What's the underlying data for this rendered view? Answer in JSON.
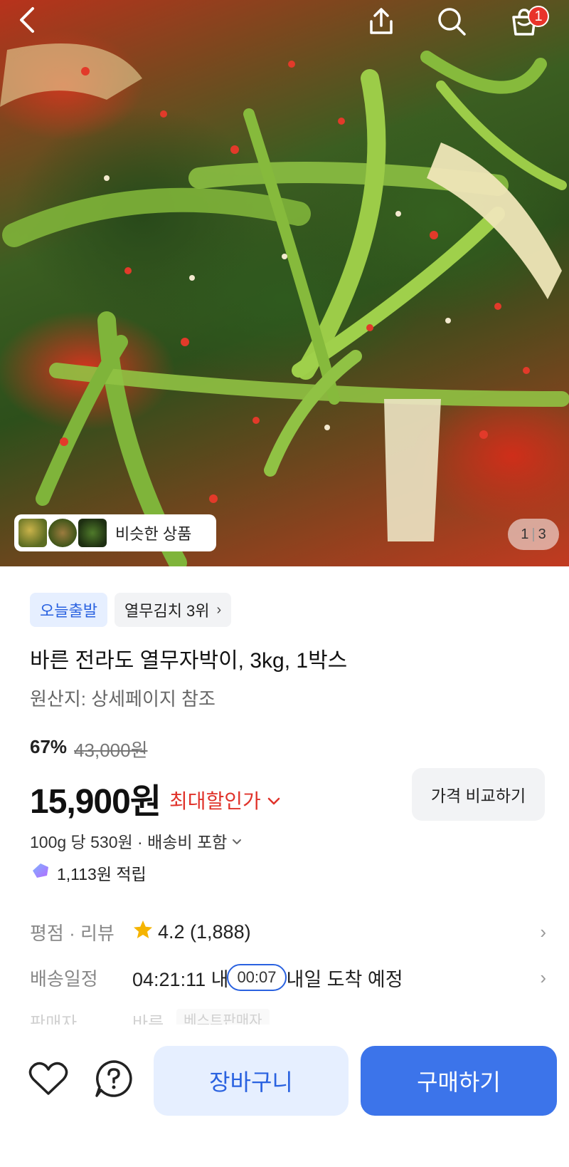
{
  "header": {
    "back_icon": "chevron-left-icon",
    "share_icon": "share-icon",
    "search_icon": "search-icon",
    "cart_icon": "cart-icon",
    "cart_count": "1"
  },
  "gallery": {
    "similar_label": "비슷한 상품",
    "page_current": "1",
    "page_total": "3"
  },
  "product": {
    "badges": [
      "오늘출발",
      "열무김치 3위"
    ],
    "title": "바른 전라도 열무자박이, 3kg, 1박스",
    "origin": "원산지: 상세페이지 참조",
    "discount_percent": "67%",
    "original_price": "43,000원",
    "price": "15,900원",
    "max_discount_label": "최대할인가",
    "compare_label": "가격 비교하기",
    "unit_price": "100g 당 530원 · 배송비 포함",
    "points": "1,113원 적립"
  },
  "info_rows": {
    "rating_label": "평점 · 리뷰",
    "rating_value": "4.2 (1,888)",
    "delivery_label": "배송일정",
    "delivery_countdown": "04:21:11 내",
    "delivery_timer": "00:07",
    "delivery_eta": "내일 도착 예정",
    "seller_label": "판매자",
    "seller_name": "바른",
    "seller_badge": "베스트판매자"
  },
  "bottom_bar": {
    "add_to_cart": "장바구니",
    "buy_now": "구매하기"
  },
  "colors": {
    "accent_blue": "#3c74ea",
    "light_blue": "#e6efff",
    "discount_red": "#e0322a",
    "badge_red": "#e8332a",
    "star_gold": "#f5b400"
  }
}
